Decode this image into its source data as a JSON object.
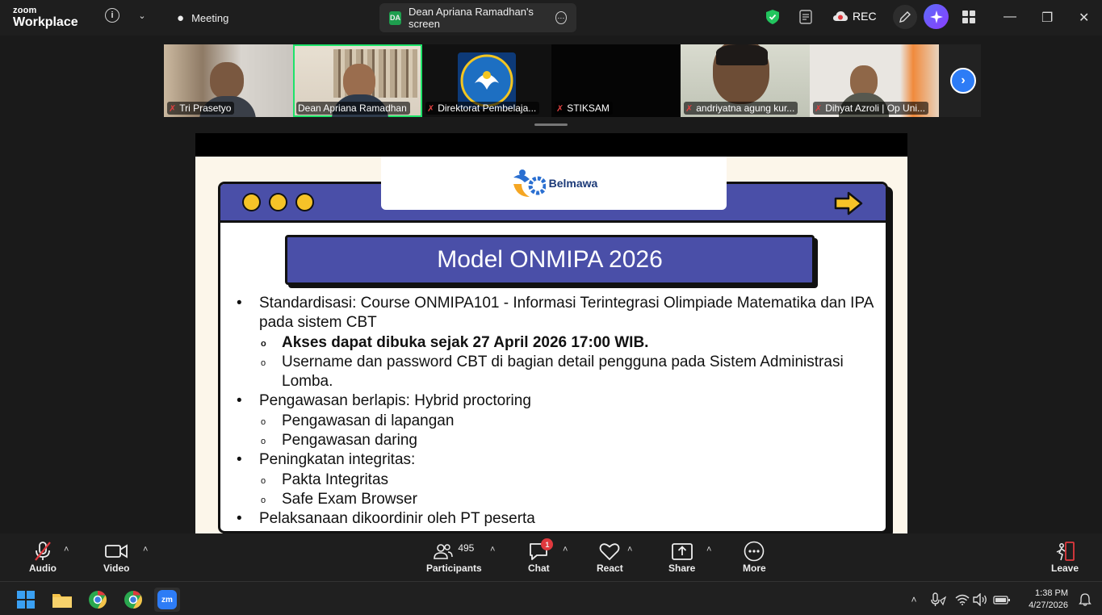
{
  "titlebar": {
    "brand_line1": "zoom",
    "brand_line2": "Workplace",
    "tabs": [
      {
        "label": "Meeting"
      },
      {
        "badge": "DA",
        "label": "Dean Apriana Ramadhan's screen"
      }
    ],
    "rec_label": "REC"
  },
  "participants_strip": [
    {
      "name": "Tri Prasetyo"
    },
    {
      "name": "Dean Apriana Ramadhan"
    },
    {
      "name": "Direktorat Pembelaja..."
    },
    {
      "name": "STIKSAM"
    },
    {
      "name": "andriyatna agung kur..."
    },
    {
      "name": "Dihyat Azroli | Op Uni..."
    }
  ],
  "slide": {
    "logo_text": "Belmawa",
    "title": "Model ONMIPA 2026",
    "bullets": [
      {
        "text": "Standardisasi: Course ONMIPA101 - Informasi Terintegrasi Olimpiade Matematika dan IPA pada sistem CBT",
        "subs": [
          "Akses dapat dibuka sejak 27 April 2026 17:00 WIB.",
          "Username dan password CBT di bagian detail pengguna pada Sistem Administrasi Lomba."
        ]
      },
      {
        "text": "Pengawasan berlapis: Hybrid proctoring",
        "subs": [
          "Pengawasan di lapangan",
          "Pengawasan daring"
        ]
      },
      {
        "text": "Peningkatan integritas:",
        "subs": [
          "Pakta Integritas",
          "Safe Exam Browser"
        ]
      },
      {
        "text": "Pelaksanaan dikoordinir oleh PT peserta",
        "subs": []
      }
    ]
  },
  "controls": {
    "audio": "Audio",
    "video": "Video",
    "participants": "Participants",
    "participants_count": "495",
    "chat": "Chat",
    "chat_badge": "1",
    "react": "React",
    "share": "Share",
    "more": "More",
    "leave": "Leave"
  },
  "taskbar": {
    "zoom_app": "zm",
    "time": "1:38 PM",
    "date": "4/27/2026"
  },
  "colors": {
    "slide_purple": "#4a4fa8",
    "dot_yellow": "#f6c328",
    "speaker_green": "#1ee36a",
    "zoom_blue": "#2d7cf6"
  }
}
